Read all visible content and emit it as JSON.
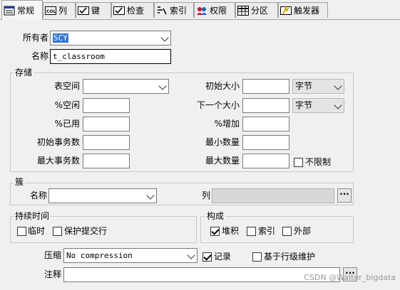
{
  "tabs": [
    {
      "label": "常规",
      "icon": "properties-icon",
      "active": true
    },
    {
      "label": "列",
      "icon": "column-icon",
      "active": false
    },
    {
      "label": "键",
      "icon": "key-icon",
      "active": false
    },
    {
      "label": "检查",
      "icon": "check-icon",
      "active": false
    },
    {
      "label": "索引",
      "icon": "index-icon",
      "active": false
    },
    {
      "label": "权限",
      "icon": "permission-icon",
      "active": false
    },
    {
      "label": "分区",
      "icon": "partition-icon",
      "active": false
    },
    {
      "label": "触发器",
      "icon": "trigger-icon",
      "active": false
    }
  ],
  "owner": {
    "label": "所有者",
    "value": "SCY"
  },
  "name": {
    "label": "名称",
    "value": "t_classroom"
  },
  "storage": {
    "title": "存储",
    "tablespace_label": "表空间",
    "tablespace_value": "",
    "pct_free_label": "%空闲",
    "pct_used_label": "%已用",
    "initrans_label": "初始事务数",
    "maxtrans_label": "最大事务数",
    "initial_label": "初始大小",
    "initial_unit": "字节",
    "next_label": "下一个大小",
    "next_unit": "字节",
    "pct_increase_label": "%增加",
    "min_extents_label": "最小数量",
    "max_extents_label": "最大数量",
    "unlimited_label": "不限制",
    "unlimited_checked": false
  },
  "cluster": {
    "title": "簇",
    "name_label": "名称",
    "name_value": "",
    "columns_label": "列",
    "columns_value": ""
  },
  "duration": {
    "title": "持续时间",
    "temporary_label": "临时",
    "temporary_checked": false,
    "preserve_label": "保护提交行",
    "preserve_checked": false
  },
  "organization": {
    "title": "构成",
    "heap_label": "堆积",
    "heap_checked": true,
    "index_label": "索引",
    "index_checked": false,
    "external_label": "外部",
    "external_checked": false
  },
  "compression": {
    "label": "压缩",
    "value": "No compression"
  },
  "logging": {
    "label": "记录",
    "checked": true
  },
  "row_movement": {
    "label": "基于行级维护",
    "checked": false
  },
  "comment": {
    "label": "注释",
    "value": ""
  },
  "watermark": "CSDN @Walter_bigdata",
  "colors": {
    "selection": "#3175d0",
    "background": "#f0f0f0"
  }
}
